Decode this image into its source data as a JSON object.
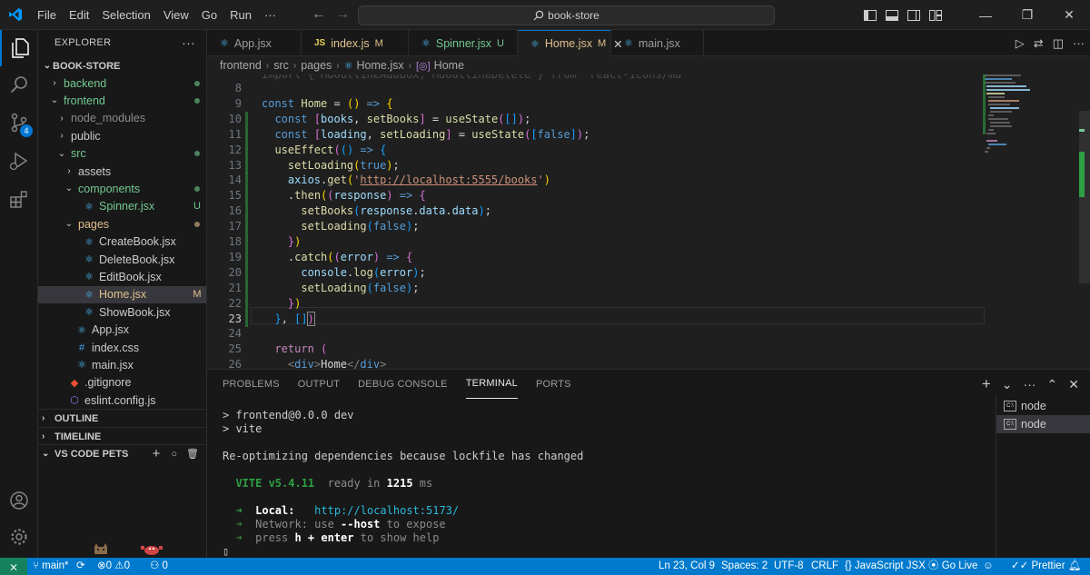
{
  "titlebar": {
    "menu": [
      "File",
      "Edit",
      "Selection",
      "View",
      "Go",
      "Run",
      "···"
    ],
    "search_text": "book-store",
    "search_icon": "search-icon",
    "nav_back_icon": "arrow-left-icon",
    "nav_forward_icon": "arrow-right-icon",
    "layout_icons": [
      "toggle-primary-sidebar-icon",
      "toggle-panel-icon",
      "toggle-secondary-sidebar-icon",
      "customize-layout-icon"
    ],
    "window_controls": [
      "minimize-icon",
      "restore-icon",
      "close-icon"
    ]
  },
  "activity_bar": {
    "items": [
      "explorer-icon",
      "search-icon",
      "source-control-icon",
      "run-debug-icon",
      "extensions-icon"
    ],
    "scm_badge": "4",
    "bottom": [
      "account-icon",
      "settings-gear-icon"
    ]
  },
  "sidebar": {
    "title": "EXPLORER",
    "more": "···",
    "root": "BOOK-STORE",
    "tree": [
      {
        "label": "backend",
        "type": "folder",
        "open": false,
        "depth": 1,
        "mark": "dot",
        "color": "#73c991"
      },
      {
        "label": "frontend",
        "type": "folder",
        "open": true,
        "depth": 1,
        "mark": "dot",
        "color": "#73c991"
      },
      {
        "label": "node_modules",
        "type": "folder",
        "open": false,
        "depth": 2,
        "mark": "",
        "color": "#8b8b8b"
      },
      {
        "label": "public",
        "type": "folder",
        "open": false,
        "depth": 2,
        "mark": "",
        "color": "#cccccc"
      },
      {
        "label": "src",
        "type": "folder",
        "open": true,
        "depth": 2,
        "mark": "dot",
        "color": "#73c991"
      },
      {
        "label": "assets",
        "type": "folder",
        "open": false,
        "depth": 3,
        "mark": "",
        "color": "#cccccc"
      },
      {
        "label": "components",
        "type": "folder",
        "open": true,
        "depth": 3,
        "mark": "dot",
        "color": "#73c991"
      },
      {
        "label": "Spinner.jsx",
        "type": "file",
        "icon": "react",
        "depth": 4,
        "mark": "U",
        "color": "#73c991"
      },
      {
        "label": "pages",
        "type": "folder",
        "open": true,
        "depth": 3,
        "mark": "dot",
        "color": "#e2c08d"
      },
      {
        "label": "CreateBook.jsx",
        "type": "file",
        "icon": "react",
        "depth": 4,
        "mark": "",
        "color": "#cccccc"
      },
      {
        "label": "DeleteBook.jsx",
        "type": "file",
        "icon": "react",
        "depth": 4,
        "mark": "",
        "color": "#cccccc"
      },
      {
        "label": "EditBook.jsx",
        "type": "file",
        "icon": "react",
        "depth": 4,
        "mark": "",
        "color": "#cccccc"
      },
      {
        "label": "Home.jsx",
        "type": "file",
        "icon": "react",
        "depth": 4,
        "mark": "M",
        "color": "#e2c08d",
        "selected": true
      },
      {
        "label": "ShowBook.jsx",
        "type": "file",
        "icon": "react",
        "depth": 4,
        "mark": "",
        "color": "#cccccc"
      },
      {
        "label": "App.jsx",
        "type": "file",
        "icon": "react",
        "depth": 3,
        "mark": "",
        "color": "#cccccc"
      },
      {
        "label": "index.css",
        "type": "file",
        "icon": "css",
        "depth": 3,
        "mark": "",
        "color": "#cccccc"
      },
      {
        "label": "main.jsx",
        "type": "file",
        "icon": "react",
        "depth": 3,
        "mark": "",
        "color": "#cccccc"
      },
      {
        "label": ".gitignore",
        "type": "file",
        "icon": "git",
        "depth": 2,
        "mark": "",
        "color": "#cccccc"
      },
      {
        "label": "eslint.config.js",
        "type": "file",
        "icon": "eslint",
        "depth": 2,
        "mark": "",
        "color": "#cccccc"
      }
    ],
    "sections": [
      "OUTLINE",
      "TIMELINE",
      "VS CODE PETS"
    ],
    "pets_actions": [
      "+",
      "○",
      "🗑"
    ]
  },
  "tabs": [
    {
      "label": "App.jsx",
      "icon": "react",
      "status": "",
      "active": false
    },
    {
      "label": "index.js",
      "icon": "js",
      "status": "M",
      "active": false
    },
    {
      "label": "Spinner.jsx",
      "icon": "react",
      "status": "U",
      "active": false
    },
    {
      "label": "Home.jsx",
      "icon": "react",
      "status": "M",
      "active": true
    },
    {
      "label": "main.jsx",
      "icon": "react",
      "status": "",
      "active": false
    }
  ],
  "breadcrumbs": [
    "frontend",
    "src",
    "pages",
    "Home.jsx",
    "Home"
  ],
  "editor": {
    "partial_top": "import { MdOutlineAddBox, MdOutlineDelete } from 'react-icons/md'",
    "current_line": 23,
    "lines": [
      {
        "n": 8,
        "html": ""
      },
      {
        "n": 9,
        "html": "<span class='k'>const</span> <span class='f'>Home</span> <span class='p'>=</span> <span class='by'>()</span> <span class='k'>=&gt;</span> <span class='by'>{</span>"
      },
      {
        "n": 10,
        "html": "  <span class='k'>const</span> <span class='bb'>[</span><span class='v'>books</span><span class='p'>,</span> <span class='f'>setBooks</span><span class='bb'>]</span> <span class='p'>=</span> <span class='f'>useState</span><span class='bb'>(</span><span class='bl'>[]</span><span class='bb'>)</span><span class='p'>;</span>"
      },
      {
        "n": 11,
        "html": "  <span class='k'>const</span> <span class='bb'>[</span><span class='v'>loading</span><span class='p'>,</span> <span class='f'>setLoading</span><span class='bb'>]</span> <span class='p'>=</span> <span class='f'>useState</span><span class='bb'>(</span><span class='bl'>[</span><span class='k'>false</span><span class='bl'>]</span><span class='bb'>)</span><span class='p'>;</span>"
      },
      {
        "n": 12,
        "html": "  <span class='f'>useEffect</span><span class='bb'>(</span><span class='bl'>()</span> <span class='k'>=&gt;</span> <span class='bl'>{</span>"
      },
      {
        "n": 13,
        "html": "    <span class='f'>setLoading</span><span class='by'>(</span><span class='k'>true</span><span class='by'>)</span><span class='p'>;</span>"
      },
      {
        "n": 14,
        "html": "    <span class='v'>axios</span><span class='p'>.</span><span class='f'>get</span><span class='by'>(</span><span class='s'>'</span><span class='su'>http://localhost:5555/books</span><span class='s'>'</span><span class='by'>)</span>"
      },
      {
        "n": 15,
        "html": "    <span class='p'>.</span><span class='f'>then</span><span class='by'>(</span><span class='bb'>(</span><span class='v'>response</span><span class='bb'>)</span> <span class='k'>=&gt;</span> <span class='bb'>{</span>"
      },
      {
        "n": 16,
        "html": "      <span class='f'>setBooks</span><span class='bl'>(</span><span class='v'>response</span><span class='p'>.</span><span class='v'>data</span><span class='p'>.</span><span class='v'>data</span><span class='bl'>)</span><span class='p'>;</span>"
      },
      {
        "n": 17,
        "html": "      <span class='f'>setLoading</span><span class='bl'>(</span><span class='k'>false</span><span class='bl'>)</span><span class='p'>;</span>"
      },
      {
        "n": 18,
        "html": "    <span class='bb'>}</span><span class='by'>)</span>"
      },
      {
        "n": 19,
        "html": "    <span class='p'>.</span><span class='f'>catch</span><span class='by'>(</span><span class='bb'>(</span><span class='v'>error</span><span class='bb'>)</span> <span class='k'>=&gt;</span> <span class='bb'>{</span>"
      },
      {
        "n": 20,
        "html": "      <span class='v'>console</span><span class='p'>.</span><span class='f'>log</span><span class='bl'>(</span><span class='v'>error</span><span class='bl'>)</span><span class='p'>;</span>"
      },
      {
        "n": 21,
        "html": "      <span class='f'>setLoading</span><span class='bl'>(</span><span class='k'>false</span><span class='bl'>)</span><span class='p'>;</span>"
      },
      {
        "n": 22,
        "html": "    <span class='bb'>}</span><span class='by'>)</span>"
      },
      {
        "n": 23,
        "html": "  <span class='bl'>}</span><span class='p'>,</span> <span class='bl'>[]</span><span class='bb' style='outline:1px solid #888'>)</span>"
      },
      {
        "n": 24,
        "html": ""
      },
      {
        "n": 25,
        "html": "  <span class='kc'>return</span> <span class='bb'>(</span>"
      },
      {
        "n": 26,
        "html": "    <span class='tagb'>&lt;</span><span class='tag'>div</span><span class='tagb'>&gt;</span><span class='p'>Home</span><span class='tagb'>&lt;/</span><span class='tag'>div</span><span class='tagb'>&gt;</span>"
      }
    ]
  },
  "panel": {
    "tabs": [
      "PROBLEMS",
      "OUTPUT",
      "DEBUG CONSOLE",
      "TERMINAL",
      "PORTS"
    ],
    "active_tab": "TERMINAL",
    "actions": [
      "+",
      "⌄",
      "···",
      "⌃",
      "✕"
    ],
    "terminal_lines": [
      "> frontend@0.0.0 dev",
      "> vite",
      "",
      "Re-optimizing dependencies because lockfile has changed",
      "",
      "  VITE v5.4.11  ready in 1215 ms",
      "",
      "  ➜  Local:   http://localhost:5173/",
      "  ➜  Network: use --host to expose",
      "  ➜  press h + enter to show help",
      "▯"
    ],
    "terminals": [
      "node",
      "node"
    ],
    "terminal_icon_text": "C:\\"
  },
  "statusbar": {
    "remote_icon": "remote-icon",
    "branch": "main*",
    "sync_icon": "sync-icon",
    "errors": "0",
    "warnings": "0",
    "ports": "0",
    "position": "Ln 23, Col 9",
    "spaces": "Spaces: 2",
    "encoding": "UTF-8",
    "eol": "CRLF",
    "language": "JavaScript JSX",
    "golive": "Go Live",
    "prettier": "Prettier",
    "pets": [
      "cat-pet",
      "crab-pet"
    ]
  },
  "colors": {
    "accent": "#0078d4",
    "statusbar": "#007acc",
    "modified": "#e2c08d",
    "untracked": "#73c991"
  }
}
